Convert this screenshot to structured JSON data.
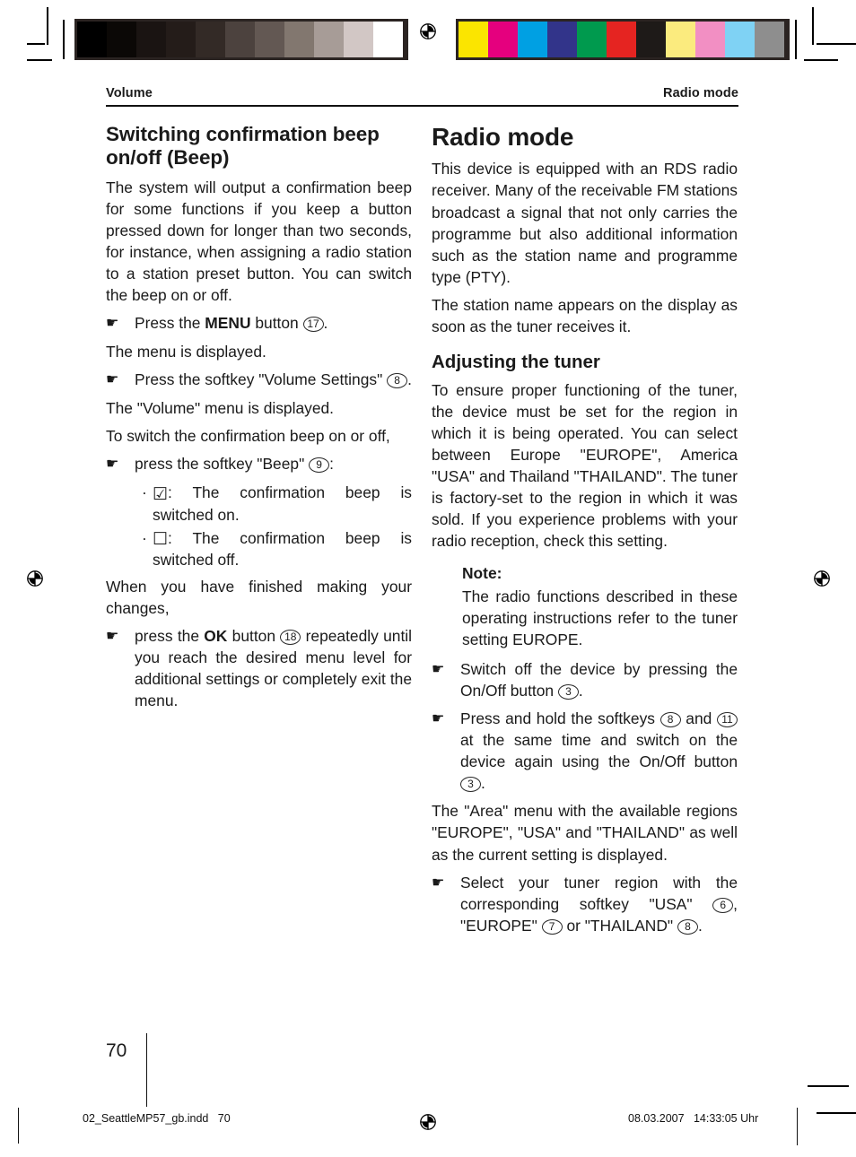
{
  "document": {
    "running_head_left": "Volume",
    "running_head_right": "Radio mode",
    "page_number": "70",
    "footer_file": "02_SeattleMP57_gb.indd   70",
    "footer_date": "08.03.2007   14:33:05 Uhr"
  },
  "icons": {
    "hand_bullet": "☛",
    "checkbox_checked": "☑",
    "checkbox_empty": "☐",
    "bullet_dot": "·"
  },
  "calibration": {
    "gray_bar_label": "grayscale-calibration-bar",
    "color_bar_label": "color-calibration-bar",
    "grayscale_swatches": [
      "#000000",
      "#0b0806",
      "#1a1412",
      "#241c19",
      "#332a26",
      "#4c423e",
      "#635853",
      "#82776f",
      "#a79c97",
      "#d2c7c5",
      "#ffffff"
    ],
    "color_swatches": [
      "#fbe500",
      "#e5007e",
      "#00a0e3",
      "#32348a",
      "#009a4e",
      "#e52421",
      "#1e1a18",
      "#fbeb7e",
      "#f28fc3",
      "#7fd2f4",
      "#8e8e8e"
    ]
  },
  "left_column": {
    "heading": "Switching confirmation beep on/off (Beep)",
    "intro": "The system will output a confirmation beep for some functions if you keep a button pressed down for longer than two seconds, for instance, when assigning a radio station to a station preset button. You can switch the beep on or off.",
    "step1_pre": "Press the ",
    "step1_bold": "MENU",
    "step1_mid": " button ",
    "step1_ref": "17",
    "step1_post": ".",
    "result1": "The menu is displayed.",
    "step2_pre": "Press the softkey \"Volume Settings\" ",
    "step2_ref": "8",
    "step2_post": ".",
    "result2": "The \"Volume\" menu is displayed.",
    "lead3": "To switch the confirmation beep on or off,",
    "step3_pre": "press the softkey \"Beep\" ",
    "step3_ref": "9",
    "step3_post": ":",
    "option_on": ": The confirmation beep is switched on.",
    "option_off": ": The confirmation beep is switched off.",
    "closing": "When you have finished making your changes,",
    "step4_pre": "press the ",
    "step4_bold": "OK",
    "step4_mid": " button ",
    "step4_ref": "18",
    "step4_post": " repeatedly until you reach the desired menu level for additional settings or completely exit the menu."
  },
  "right_column": {
    "chapter_title": "Radio mode",
    "para1": "This device is equipped with an RDS radio receiver. Many of the receivable FM stations broadcast a signal that not only carries the programme but also additional information such as the station name and programme type (PTY).",
    "para2": "The station name appears on the display as soon as the tuner receives it.",
    "section_title": "Adjusting the tuner",
    "para3": "To ensure proper functioning of the tuner, the device must be set for the region in which it is being operated. You can select between Europe \"EUROPE\", America \"USA\" and Thailand \"THAILAND\". The tuner is factory-set to the region in which it was sold. If you experience problems with your radio reception, check this setting.",
    "note_title": "Note:",
    "note_body": "The radio functions described in these operating instructions refer to the tuner setting EUROPE.",
    "step1_pre": "Switch off the device by pressing the On/Off button ",
    "step1_ref": "3",
    "step1_post": ".",
    "step2_pre": "Press and hold the softkeys ",
    "step2_ref_a": "8",
    "step2_mid": " and ",
    "step2_ref_b": "11",
    "step2_mid2": " at the same time and switch on the device again using the On/Off button ",
    "step2_ref_c": "3",
    "step2_post": ".",
    "result1": "The \"Area\" menu with the available regions \"EUROPE\", \"USA\" and \"THAILAND\" as well as the current setting is displayed.",
    "step3_pre": "Select your tuner region with the corresponding softkey \"USA\" ",
    "step3_ref_a": "6",
    "step3_mid": ", \"EUROPE\" ",
    "step3_ref_b": "7",
    "step3_mid2": " or \"THAILAND\" ",
    "step3_ref_c": "8",
    "step3_post": "."
  }
}
